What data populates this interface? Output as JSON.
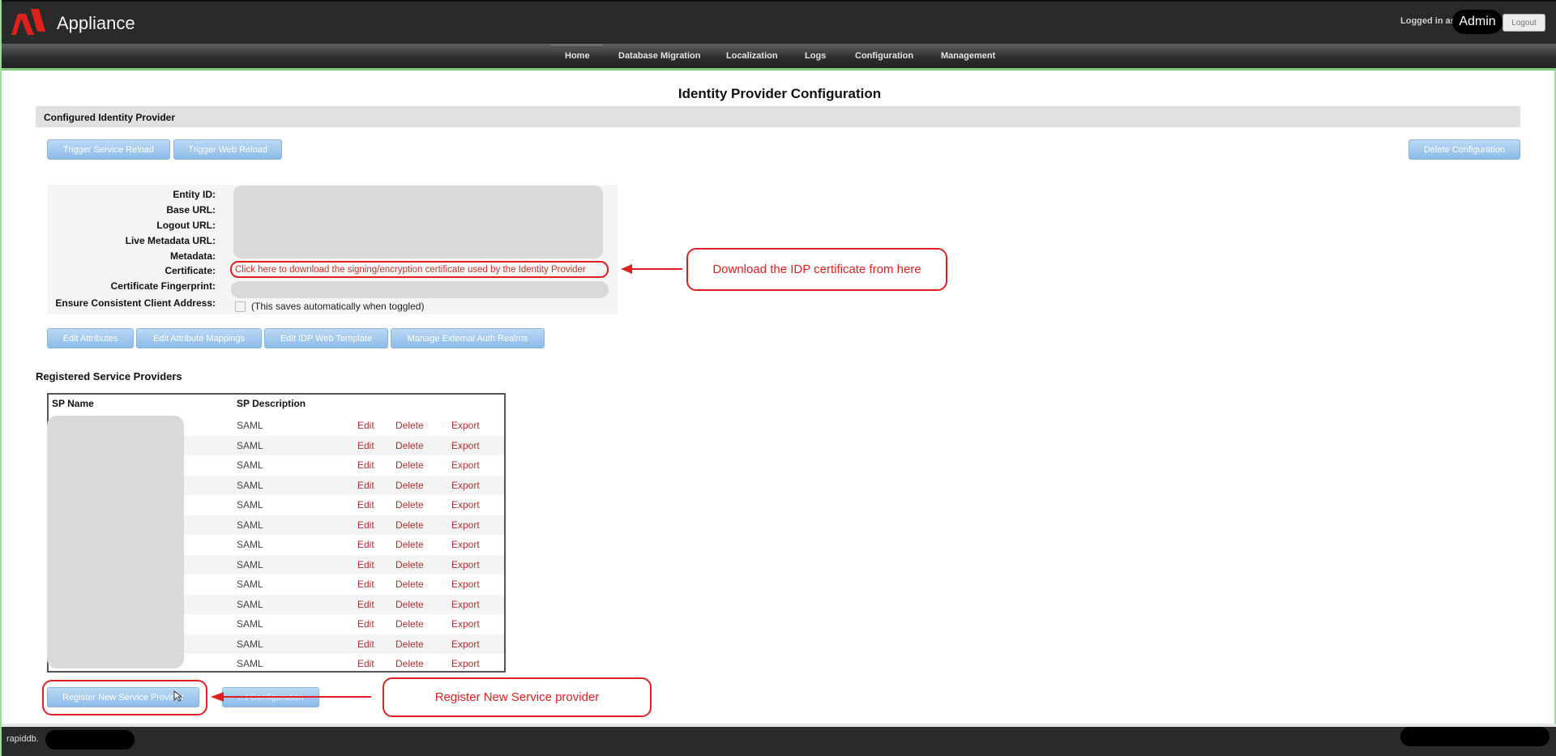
{
  "app": {
    "name": "Appliance"
  },
  "header": {
    "logged_in_label": "Logged in as:",
    "user": "Admin",
    "logout": "Logout"
  },
  "nav": {
    "items": [
      "Home",
      "Database Migration",
      "Localization",
      "Logs",
      "Configuration",
      "Management"
    ]
  },
  "page": {
    "title": "Identity Provider Configuration"
  },
  "idp": {
    "section_title": "Configured Identity Provider",
    "buttons": {
      "trigger_service_reload": "Trigger Service Reload",
      "trigger_web_reload": "Trigger Web Reload",
      "delete_configuration": "Delete Configuration"
    },
    "labels": {
      "entity_id": "Entity ID:",
      "base_url": "Base URL:",
      "logout_url": "Logout URL:",
      "live_metadata_url": "Live Metadata URL:",
      "metadata": "Metadata:",
      "certificate": "Certificate:",
      "certificate_fingerprint": "Certificate Fingerprint:",
      "ensure_consistent": "Ensure Consistent Client Address:"
    },
    "certificate_link": "Click here to download the signing/encryption certificate used by the Identity Provider",
    "toggle_note": "(This saves automatically when toggled)",
    "action_buttons": {
      "edit_attributes": "Edit Attributes",
      "edit_attribute_mappings": "Edit Attribute Mappings",
      "edit_idp_web_template": "Edit IDP Web Template",
      "manage_external_auth_realms": "Manage External Auth Realms"
    }
  },
  "sp": {
    "heading": "Registered Service Providers",
    "columns": {
      "name": "SP Name",
      "description": "SP Description"
    },
    "rows": [
      {
        "description": "SAML",
        "edit": "Edit",
        "delete": "Delete",
        "export": "Export"
      },
      {
        "description": "SAML",
        "edit": "Edit",
        "delete": "Delete",
        "export": "Export"
      },
      {
        "description": "SAML",
        "edit": "Edit",
        "delete": "Delete",
        "export": "Export"
      },
      {
        "description": "SAML",
        "edit": "Edit",
        "delete": "Delete",
        "export": "Export"
      },
      {
        "description": "SAML",
        "edit": "Edit",
        "delete": "Delete",
        "export": "Export"
      },
      {
        "description": "SAML",
        "edit": "Edit",
        "delete": "Delete",
        "export": "Export"
      },
      {
        "description": "SAML",
        "edit": "Edit",
        "delete": "Delete",
        "export": "Export"
      },
      {
        "description": "SAML",
        "edit": "Edit",
        "delete": "Delete",
        "export": "Export"
      },
      {
        "description": "SAML",
        "edit": "Edit",
        "delete": "Delete",
        "export": "Export"
      },
      {
        "description": "SAML",
        "edit": "Edit",
        "delete": "Delete",
        "export": "Export"
      },
      {
        "description": "SAML",
        "edit": "Edit",
        "delete": "Delete",
        "export": "Export"
      },
      {
        "description": "SAML",
        "edit": "Edit",
        "delete": "Delete",
        "export": "Export"
      },
      {
        "description": "SAML",
        "edit": "Edit",
        "delete": "Delete",
        "export": "Export"
      }
    ],
    "register_button": "Register New Service Provider",
    "second_button": "...t Configuration"
  },
  "annotations": {
    "certificate_callout": "Download the IDP certificate from here",
    "register_callout": "Register New Service provider"
  },
  "footer": {
    "host": "rapiddb."
  },
  "colors": {
    "annotation_red": "#e02020",
    "button_blue": "#8bbbe8",
    "link_red": "#b03030"
  }
}
